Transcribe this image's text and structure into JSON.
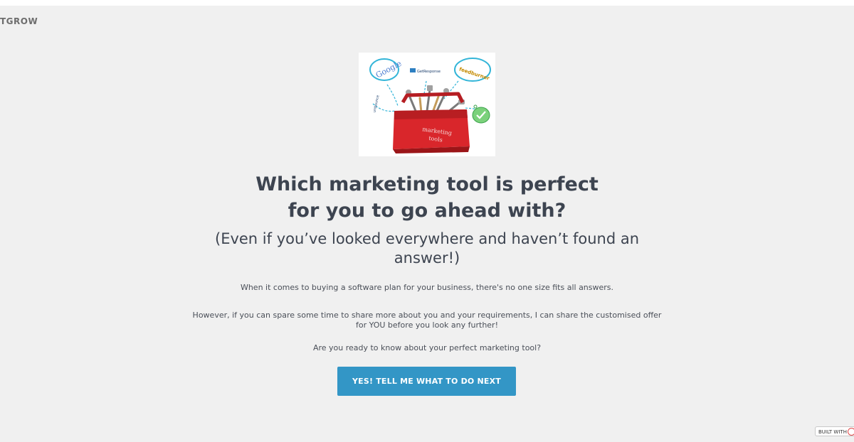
{
  "brand": {
    "text": "TGROW"
  },
  "hero_image": {
    "icon_names": [
      "google-logo-icon",
      "getresponse-logo-icon",
      "feedburner-logo-icon",
      "unbounce-logo-icon",
      "checkmark-badge-icon",
      "toolbox-icon"
    ],
    "toolbox_label_line1": "marketing",
    "toolbox_label_line2": "tools",
    "logo_google": "Google",
    "logo_getresponse": "GetResponse",
    "logo_feedburner": "feedburner",
    "logo_side": "unbounce"
  },
  "headline": {
    "line1": "Which marketing tool is perfect",
    "line2": "for you to go ahead with?"
  },
  "subheadline": {
    "line1": "(Even if you’ve looked everywhere and haven’t found an",
    "line2": "answer!)"
  },
  "body": {
    "p1": "When it comes to buying a software plan for your business, there's no one size fits all answers.",
    "p2_line1": "However, if you can spare some time to share more about you and your requirements, I can share the customised offer",
    "p2_line2": "for YOU before you look any further!",
    "p3": "Are you ready to know about your perfect marketing tool?"
  },
  "cta": {
    "label": "YES! TELL ME WHAT TO DO NEXT"
  },
  "badge": {
    "text": "BUILT WITH"
  },
  "colors": {
    "accent": "#3396c6",
    "background": "#f0f0f0",
    "text": "#3d4450",
    "toolbox": "#d9262b"
  }
}
